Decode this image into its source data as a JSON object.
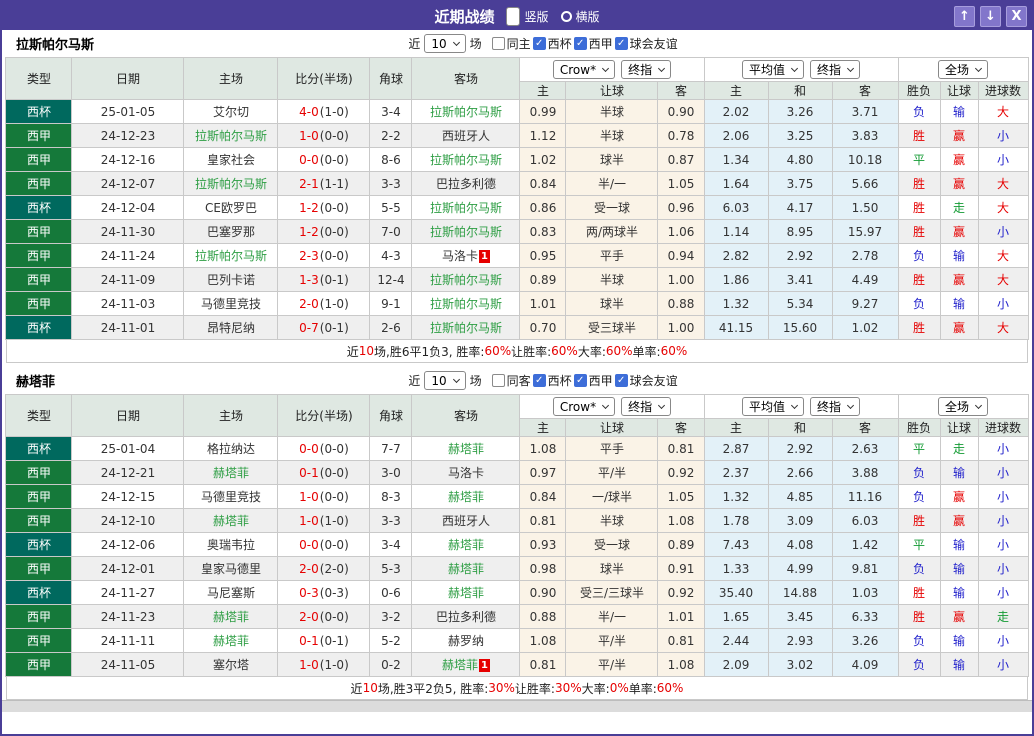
{
  "window": {
    "title": "近期战绩",
    "view_options": [
      {
        "label": "竖版",
        "selected": true
      },
      {
        "label": "横版",
        "selected": false
      }
    ],
    "controls": {
      "up_icon": "↑",
      "down_icon": "↓",
      "close_icon": "X"
    }
  },
  "colors": {
    "titlebar_bg": "#4a3e97",
    "cup_bg": "#00695e",
    "liga_bg": "#15793a",
    "team_green": "#2e9e44",
    "score_red": "#e60000",
    "win_red": "#e60000",
    "lose_blue": "#2323cc",
    "draw_green": "#149b34",
    "odds_bg": "#faf3e7",
    "avg_bg": "#e3f1f8",
    "header_bg": "#dfe8e2",
    "checkbox_blue": "#3d6dd8"
  },
  "tables": [
    {
      "team": "拉斯帕尔马斯",
      "filter": {
        "near_label": "近",
        "count": "10",
        "matches_label": "场",
        "same_label": "同主",
        "same_checked": false,
        "leagues": [
          {
            "label": "西杯",
            "checked": true
          },
          {
            "label": "西甲",
            "checked": true
          },
          {
            "label": "球会友谊",
            "checked": true
          }
        ]
      },
      "header": {
        "cols": [
          "类型",
          "日期",
          "主场",
          "比分(半场)",
          "角球",
          "客场"
        ],
        "odds_selects": [
          "Crow*",
          "终指"
        ],
        "odds_cols": [
          "主",
          "让球",
          "客"
        ],
        "avg_selects": [
          "平均值",
          "终指"
        ],
        "avg_cols": [
          "主",
          "和",
          "客"
        ],
        "result_select": "全场",
        "result_cols": [
          "胜负",
          "让球",
          "进球数"
        ]
      },
      "rows": [
        {
          "type": "西杯",
          "date": "25-01-05",
          "home": "艾尔切",
          "home_focus": false,
          "home_card": "",
          "score": "4-0",
          "half": "(1-0)",
          "corner": "3-4",
          "away": "拉斯帕尔马斯",
          "away_focus": true,
          "away_card": "",
          "odds": [
            "0.99",
            "半球",
            "0.90"
          ],
          "avg": [
            "2.02",
            "3.26",
            "3.71"
          ],
          "result": [
            "负",
            "输",
            "大"
          ]
        },
        {
          "type": "西甲",
          "date": "24-12-23",
          "home": "拉斯帕尔马斯",
          "home_focus": true,
          "home_card": "",
          "score": "1-0",
          "half": "(0-0)",
          "corner": "2-2",
          "away": "西班牙人",
          "away_focus": false,
          "away_card": "",
          "odds": [
            "1.12",
            "半球",
            "0.78"
          ],
          "avg": [
            "2.06",
            "3.25",
            "3.83"
          ],
          "result": [
            "胜",
            "赢",
            "小"
          ]
        },
        {
          "type": "西甲",
          "date": "24-12-16",
          "home": "皇家社会",
          "home_focus": false,
          "home_card": "",
          "score": "0-0",
          "half": "(0-0)",
          "corner": "8-6",
          "away": "拉斯帕尔马斯",
          "away_focus": true,
          "away_card": "",
          "odds": [
            "1.02",
            "球半",
            "0.87"
          ],
          "avg": [
            "1.34",
            "4.80",
            "10.18"
          ],
          "result": [
            "平",
            "赢",
            "小"
          ]
        },
        {
          "type": "西甲",
          "date": "24-12-07",
          "home": "拉斯帕尔马斯",
          "home_focus": true,
          "home_card": "",
          "score": "2-1",
          "half": "(1-1)",
          "corner": "3-3",
          "away": "巴拉多利德",
          "away_focus": false,
          "away_card": "",
          "odds": [
            "0.84",
            "半/一",
            "1.05"
          ],
          "avg": [
            "1.64",
            "3.75",
            "5.66"
          ],
          "result": [
            "胜",
            "赢",
            "大"
          ]
        },
        {
          "type": "西杯",
          "date": "24-12-04",
          "home": "CE欧罗巴",
          "home_focus": false,
          "home_card": "",
          "score": "1-2",
          "half": "(0-0)",
          "corner": "5-5",
          "away": "拉斯帕尔马斯",
          "away_focus": true,
          "away_card": "",
          "odds": [
            "0.86",
            "受一球",
            "0.96"
          ],
          "avg": [
            "6.03",
            "4.17",
            "1.50"
          ],
          "result": [
            "胜",
            "走",
            "大"
          ]
        },
        {
          "type": "西甲",
          "date": "24-11-30",
          "home": "巴塞罗那",
          "home_focus": false,
          "home_card": "",
          "score": "1-2",
          "half": "(0-0)",
          "corner": "7-0",
          "away": "拉斯帕尔马斯",
          "away_focus": true,
          "away_card": "",
          "odds": [
            "0.83",
            "两/两球半",
            "1.06"
          ],
          "avg": [
            "1.14",
            "8.95",
            "15.97"
          ],
          "result": [
            "胜",
            "赢",
            "小"
          ]
        },
        {
          "type": "西甲",
          "date": "24-11-24",
          "home": "拉斯帕尔马斯",
          "home_focus": true,
          "home_card": "",
          "score": "2-3",
          "half": "(0-0)",
          "corner": "4-3",
          "away": "马洛卡",
          "away_focus": false,
          "away_card": "1",
          "odds": [
            "0.95",
            "平手",
            "0.94"
          ],
          "avg": [
            "2.82",
            "2.92",
            "2.78"
          ],
          "result": [
            "负",
            "输",
            "大"
          ]
        },
        {
          "type": "西甲",
          "date": "24-11-09",
          "home": "巴列卡诺",
          "home_focus": false,
          "home_card": "",
          "score": "1-3",
          "half": "(0-1)",
          "corner": "12-4",
          "away": "拉斯帕尔马斯",
          "away_focus": true,
          "away_card": "",
          "odds": [
            "0.89",
            "半球",
            "1.00"
          ],
          "avg": [
            "1.86",
            "3.41",
            "4.49"
          ],
          "result": [
            "胜",
            "赢",
            "大"
          ]
        },
        {
          "type": "西甲",
          "date": "24-11-03",
          "home": "马德里竞技",
          "home_focus": false,
          "home_card": "",
          "score": "2-0",
          "half": "(1-0)",
          "corner": "9-1",
          "away": "拉斯帕尔马斯",
          "away_focus": true,
          "away_card": "",
          "odds": [
            "1.01",
            "球半",
            "0.88"
          ],
          "avg": [
            "1.32",
            "5.34",
            "9.27"
          ],
          "result": [
            "负",
            "输",
            "小"
          ]
        },
        {
          "type": "西杯",
          "date": "24-11-01",
          "home": "昂特尼纳",
          "home_focus": false,
          "home_card": "",
          "score": "0-7",
          "half": "(0-1)",
          "corner": "2-6",
          "away": "拉斯帕尔马斯",
          "away_focus": true,
          "away_card": "",
          "odds": [
            "0.70",
            "受三球半",
            "1.00"
          ],
          "avg": [
            "41.15",
            "15.60",
            "1.02"
          ],
          "result": [
            "胜",
            "赢",
            "大"
          ]
        }
      ],
      "summary": [
        {
          "text": "近",
          "red": false
        },
        {
          "text": "10",
          "red": true
        },
        {
          "text": "场,胜6平1负3, 胜率:",
          "red": false
        },
        {
          "text": "60%",
          "red": true
        },
        {
          "text": " 让胜率:",
          "red": false
        },
        {
          "text": "60%",
          "red": true
        },
        {
          "text": " 大率:",
          "red": false
        },
        {
          "text": "60%",
          "red": true
        },
        {
          "text": " 单率:",
          "red": false
        },
        {
          "text": "60%",
          "red": true
        }
      ]
    },
    {
      "team": "赫塔菲",
      "filter": {
        "near_label": "近",
        "count": "10",
        "matches_label": "场",
        "same_label": "同客",
        "same_checked": false,
        "leagues": [
          {
            "label": "西杯",
            "checked": true
          },
          {
            "label": "西甲",
            "checked": true
          },
          {
            "label": "球会友谊",
            "checked": true
          }
        ]
      },
      "header": {
        "cols": [
          "类型",
          "日期",
          "主场",
          "比分(半场)",
          "角球",
          "客场"
        ],
        "odds_selects": [
          "Crow*",
          "终指"
        ],
        "odds_cols": [
          "主",
          "让球",
          "客"
        ],
        "avg_selects": [
          "平均值",
          "终指"
        ],
        "avg_cols": [
          "主",
          "和",
          "客"
        ],
        "result_select": "全场",
        "result_cols": [
          "胜负",
          "让球",
          "进球数"
        ]
      },
      "rows": [
        {
          "type": "西杯",
          "date": "25-01-04",
          "home": "格拉纳达",
          "home_focus": false,
          "home_card": "",
          "score": "0-0",
          "half": "(0-0)",
          "corner": "7-7",
          "away": "赫塔菲",
          "away_focus": true,
          "away_card": "",
          "odds": [
            "1.08",
            "平手",
            "0.81"
          ],
          "avg": [
            "2.87",
            "2.92",
            "2.63"
          ],
          "result": [
            "平",
            "走",
            "小"
          ]
        },
        {
          "type": "西甲",
          "date": "24-12-21",
          "home": "赫塔菲",
          "home_focus": true,
          "home_card": "",
          "score": "0-1",
          "half": "(0-0)",
          "corner": "3-0",
          "away": "马洛卡",
          "away_focus": false,
          "away_card": "",
          "odds": [
            "0.97",
            "平/半",
            "0.92"
          ],
          "avg": [
            "2.37",
            "2.66",
            "3.88"
          ],
          "result": [
            "负",
            "输",
            "小"
          ]
        },
        {
          "type": "西甲",
          "date": "24-12-15",
          "home": "马德里竞技",
          "home_focus": false,
          "home_card": "",
          "score": "1-0",
          "half": "(0-0)",
          "corner": "8-3",
          "away": "赫塔菲",
          "away_focus": true,
          "away_card": "",
          "odds": [
            "0.84",
            "一/球半",
            "1.05"
          ],
          "avg": [
            "1.32",
            "4.85",
            "11.16"
          ],
          "result": [
            "负",
            "赢",
            "小"
          ]
        },
        {
          "type": "西甲",
          "date": "24-12-10",
          "home": "赫塔菲",
          "home_focus": true,
          "home_card": "",
          "score": "1-0",
          "half": "(1-0)",
          "corner": "3-3",
          "away": "西班牙人",
          "away_focus": false,
          "away_card": "",
          "odds": [
            "0.81",
            "半球",
            "1.08"
          ],
          "avg": [
            "1.78",
            "3.09",
            "6.03"
          ],
          "result": [
            "胜",
            "赢",
            "小"
          ]
        },
        {
          "type": "西杯",
          "date": "24-12-06",
          "home": "奥瑞韦拉",
          "home_focus": false,
          "home_card": "",
          "score": "0-0",
          "half": "(0-0)",
          "corner": "3-4",
          "away": "赫塔菲",
          "away_focus": true,
          "away_card": "",
          "odds": [
            "0.93",
            "受一球",
            "0.89"
          ],
          "avg": [
            "7.43",
            "4.08",
            "1.42"
          ],
          "result": [
            "平",
            "输",
            "小"
          ]
        },
        {
          "type": "西甲",
          "date": "24-12-01",
          "home": "皇家马德里",
          "home_focus": false,
          "home_card": "",
          "score": "2-0",
          "half": "(2-0)",
          "corner": "5-3",
          "away": "赫塔菲",
          "away_focus": true,
          "away_card": "",
          "odds": [
            "0.98",
            "球半",
            "0.91"
          ],
          "avg": [
            "1.33",
            "4.99",
            "9.81"
          ],
          "result": [
            "负",
            "输",
            "小"
          ]
        },
        {
          "type": "西杯",
          "date": "24-11-27",
          "home": "马尼塞斯",
          "home_focus": false,
          "home_card": "",
          "score": "0-3",
          "half": "(0-3)",
          "corner": "0-6",
          "away": "赫塔菲",
          "away_focus": true,
          "away_card": "",
          "odds": [
            "0.90",
            "受三/三球半",
            "0.92"
          ],
          "avg": [
            "35.40",
            "14.88",
            "1.03"
          ],
          "result": [
            "胜",
            "输",
            "小"
          ]
        },
        {
          "type": "西甲",
          "date": "24-11-23",
          "home": "赫塔菲",
          "home_focus": true,
          "home_card": "",
          "score": "2-0",
          "half": "(0-0)",
          "corner": "3-2",
          "away": "巴拉多利德",
          "away_focus": false,
          "away_card": "",
          "odds": [
            "0.88",
            "半/一",
            "1.01"
          ],
          "avg": [
            "1.65",
            "3.45",
            "6.33"
          ],
          "result": [
            "胜",
            "赢",
            "走"
          ]
        },
        {
          "type": "西甲",
          "date": "24-11-11",
          "home": "赫塔菲",
          "home_focus": true,
          "home_card": "",
          "score": "0-1",
          "half": "(0-1)",
          "corner": "5-2",
          "away": "赫罗纳",
          "away_focus": false,
          "away_card": "",
          "odds": [
            "1.08",
            "平/半",
            "0.81"
          ],
          "avg": [
            "2.44",
            "2.93",
            "3.26"
          ],
          "result": [
            "负",
            "输",
            "小"
          ]
        },
        {
          "type": "西甲",
          "date": "24-11-05",
          "home": "塞尔塔",
          "home_focus": false,
          "home_card": "",
          "score": "1-0",
          "half": "(1-0)",
          "corner": "0-2",
          "away": "赫塔菲",
          "away_focus": true,
          "away_card": "1",
          "odds": [
            "0.81",
            "平/半",
            "1.08"
          ],
          "avg": [
            "2.09",
            "3.02",
            "4.09"
          ],
          "result": [
            "负",
            "输",
            "小"
          ]
        }
      ],
      "summary": [
        {
          "text": "近",
          "red": false
        },
        {
          "text": "10",
          "red": true
        },
        {
          "text": "场,胜3平2负5, 胜率:",
          "red": false
        },
        {
          "text": "30%",
          "red": true
        },
        {
          "text": " 让胜率:",
          "red": false
        },
        {
          "text": "30%",
          "red": true
        },
        {
          "text": " 大率:",
          "red": false
        },
        {
          "text": "0%",
          "red": true
        },
        {
          "text": " 单率:",
          "red": false
        },
        {
          "text": "60%",
          "red": true
        }
      ]
    }
  ]
}
